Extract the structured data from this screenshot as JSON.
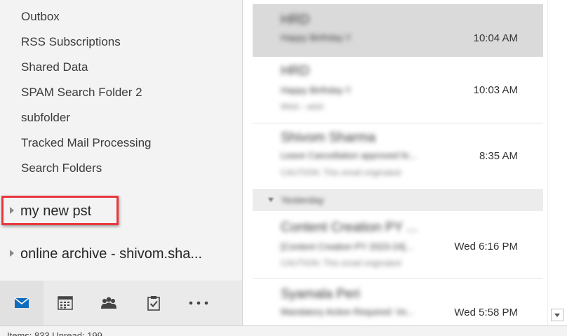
{
  "folders": [
    {
      "label": "Outbox"
    },
    {
      "label": "RSS Subscriptions"
    },
    {
      "label": "Shared Data"
    },
    {
      "label": "SPAM Search Folder 2"
    },
    {
      "label": "subfolder"
    },
    {
      "label": "Tracked Mail Processing"
    },
    {
      "label": "Search Folders"
    }
  ],
  "stores": [
    {
      "label": "my new pst"
    },
    {
      "label": "online archive - shivom.sha..."
    }
  ],
  "nav": [
    {
      "icon": "mail-icon",
      "label": "Mail"
    },
    {
      "icon": "calendar-icon",
      "label": "Calendar"
    },
    {
      "icon": "people-icon",
      "label": "People"
    },
    {
      "icon": "tasks-icon",
      "label": "Tasks"
    },
    {
      "icon": "more-icon",
      "label": "More"
    }
  ],
  "messages": [
    {
      "sender": "HRD",
      "subject": "Happy Birthday !!",
      "preview": "",
      "time": "10:04 AM",
      "selected": true
    },
    {
      "sender": "HRD",
      "subject": "Happy Birthday !!",
      "preview": "Wish - wish",
      "time": "10:03 AM",
      "selected": false
    },
    {
      "sender": "Shivom Sharma",
      "subject": "Leave Cancellation approved fo...",
      "preview": "CAUTION: This email originated",
      "time": "8:35 AM",
      "selected": false
    },
    {
      "sender": "Content Creation PY ...",
      "subject": "[Content Creation PY 2023-24]...",
      "preview": "CAUTION: This email originated",
      "time": "Wed 6:16 PM",
      "selected": false
    },
    {
      "sender": "Syamala Peri",
      "subject": "Mandatory Action Required: Vo...",
      "preview": "",
      "time": "Wed 5:58 PM",
      "selected": false
    }
  ],
  "group_header": "Yesterday",
  "status": {
    "text": "Items: 833    Unread: 199"
  },
  "colors": {
    "highlight": "#e8383d",
    "accent": "#0f6cbd"
  }
}
